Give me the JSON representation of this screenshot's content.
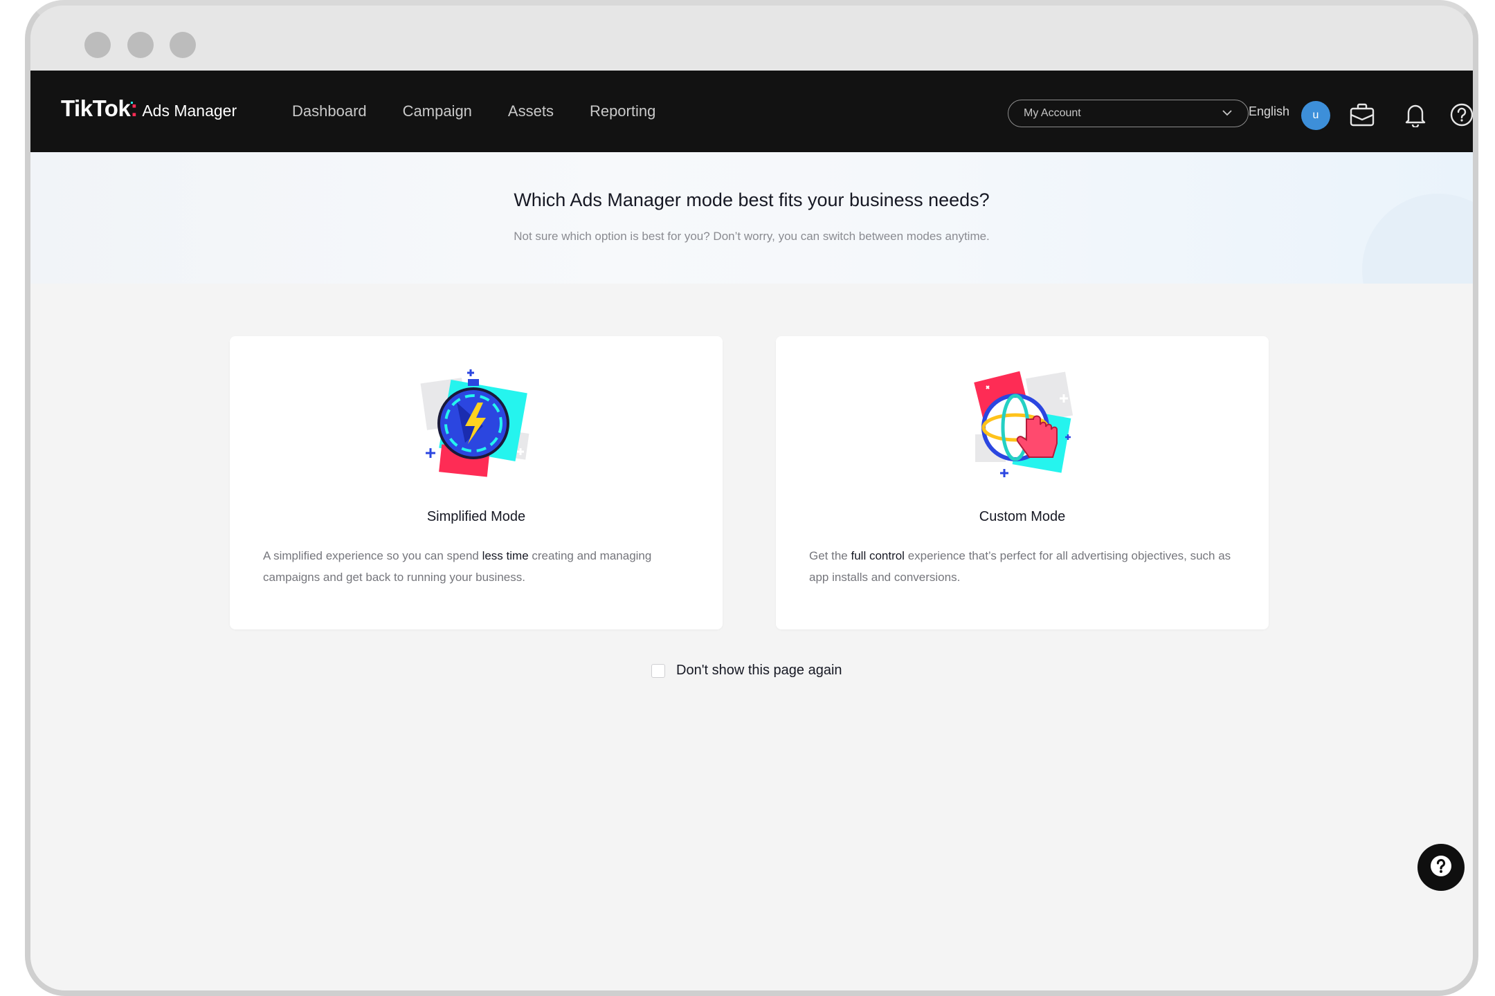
{
  "window": {
    "controls": [
      "close-dot",
      "minimize-dot",
      "maximize-dot"
    ]
  },
  "navbar": {
    "logo": {
      "brand": "TikTok",
      "colon": ":",
      "product": "Ads Manager"
    },
    "links": [
      "Dashboard",
      "Campaign",
      "Assets",
      "Reporting"
    ],
    "account_select": {
      "value": "My Account",
      "icon": "chevron-down-icon"
    },
    "language": "English",
    "avatar_initial": "u",
    "icons": [
      "briefcase-icon",
      "bell-icon",
      "help-circle-icon"
    ]
  },
  "hero": {
    "title": "Which Ads Manager mode best fits your business needs?",
    "subtitle": "Not sure which option is best for you? Don’t worry, you can switch between modes anytime."
  },
  "cards": [
    {
      "title": "Simplified Mode",
      "desc_before": "A simplified experience so you can spend ",
      "desc_bold": "less time",
      "desc_after": " creating and managing campaigns and get back to running your business.",
      "icon": "stopwatch-lightning-icon"
    },
    {
      "title": "Custom Mode",
      "desc_before": "Get the ",
      "desc_bold": "full control",
      "desc_after": " experience that’s perfect for all advertising objectives, such as app installs and conversions.",
      "icon": "globe-pointer-icon"
    }
  ],
  "dont_show": {
    "label": "Don't show this page again",
    "checked": false
  },
  "help_fab": {
    "icon": "question-icon"
  },
  "colors": {
    "navbar": "#121212",
    "brand_red": "#fe2c55",
    "brand_cyan": "#25f4ee",
    "avatar": "#3d8fd9",
    "page_bg": "#f4f4f4"
  }
}
